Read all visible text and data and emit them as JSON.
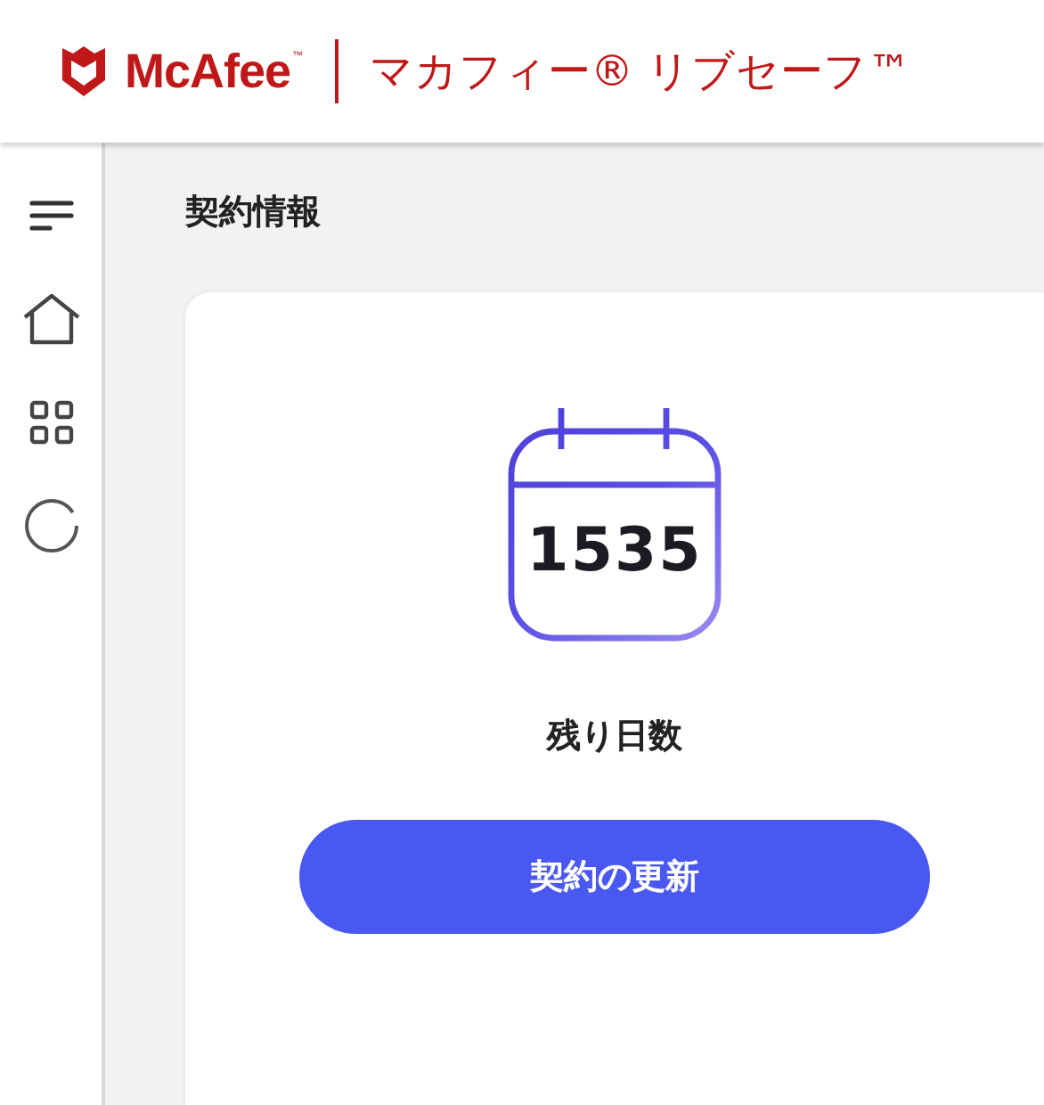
{
  "header": {
    "brand": "McAfee",
    "brand_mark": "™",
    "product": "マカフィー® リブセーフ™"
  },
  "sidebar": {
    "items": [
      {
        "kind": "menu"
      },
      {
        "kind": "home"
      },
      {
        "kind": "apps"
      },
      {
        "kind": "loading"
      }
    ]
  },
  "page": {
    "title": "契約情報"
  },
  "card": {
    "days": "1535",
    "label": "残り日数",
    "button": "契約の更新"
  }
}
